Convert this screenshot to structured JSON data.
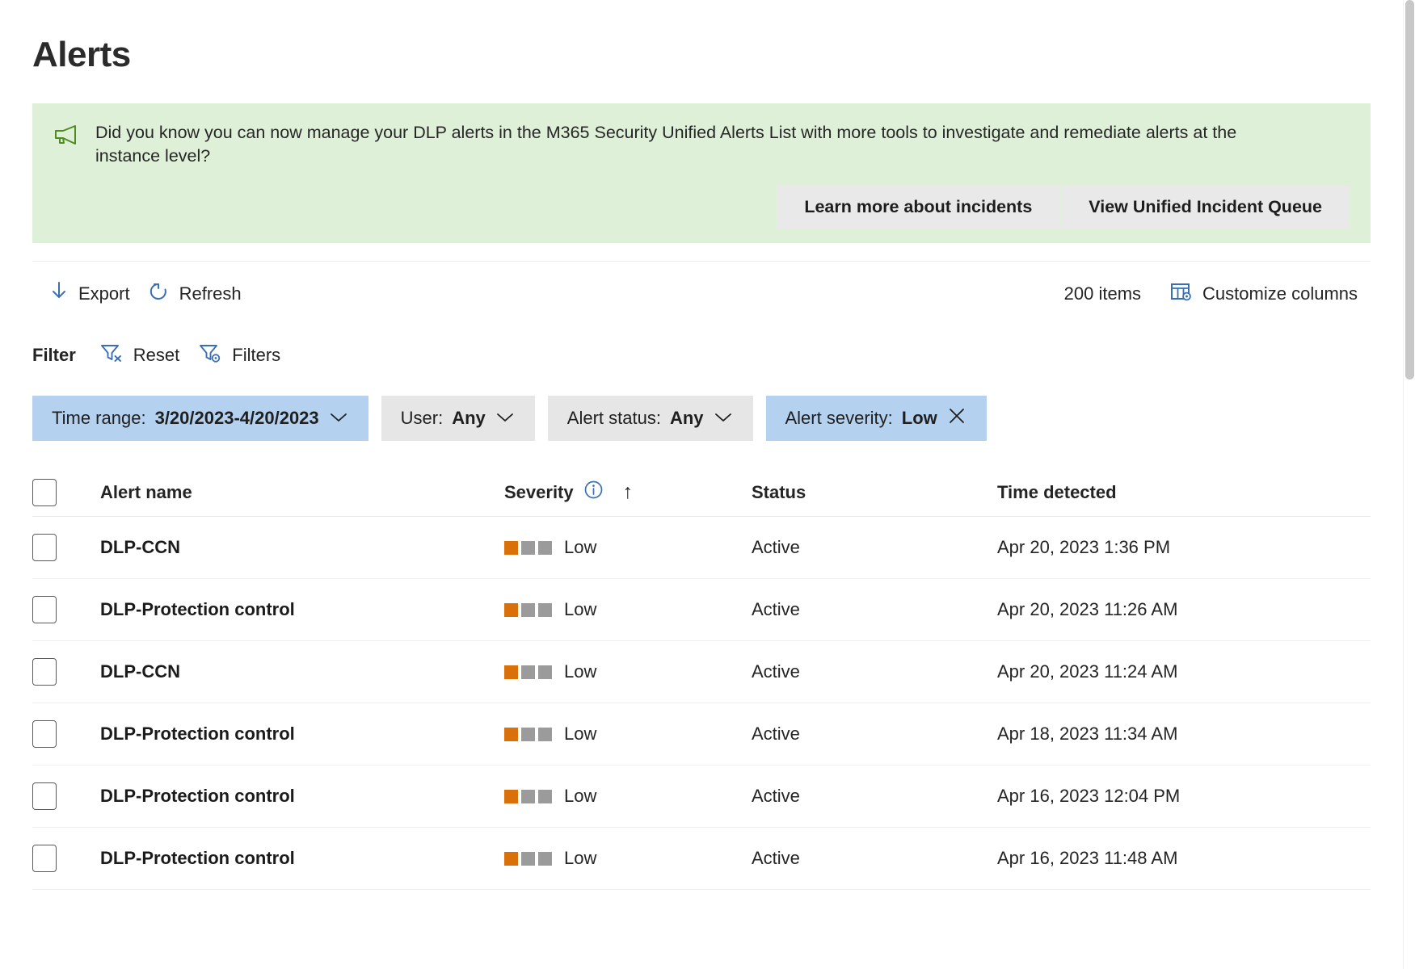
{
  "page": {
    "title": "Alerts"
  },
  "banner": {
    "icon": "megaphone-icon",
    "message": "Did you know you can now manage your DLP alerts in the M365 Security Unified Alerts List with more tools to investigate and remediate alerts at the instance level?",
    "learn_more_label": "Learn more about incidents",
    "view_queue_label": "View Unified Incident Queue",
    "background_color": "#dff0d8",
    "icon_color": "#4e8c1f"
  },
  "toolbar": {
    "export_label": "Export",
    "refresh_label": "Refresh",
    "items_count": "200 items",
    "customize_columns_label": "Customize columns",
    "accent_color": "#3a6fb5"
  },
  "filter_bar": {
    "label": "Filter",
    "reset_label": "Reset",
    "filters_label": "Filters"
  },
  "pills": [
    {
      "name": "time-range",
      "label": "Time range:",
      "value": "3/20/2023-4/20/2023",
      "active": true,
      "trailing": "chevron"
    },
    {
      "name": "user",
      "label": "User:",
      "value": "Any",
      "active": false,
      "trailing": "chevron"
    },
    {
      "name": "alert-status",
      "label": "Alert status:",
      "value": "Any",
      "active": false,
      "trailing": "chevron"
    },
    {
      "name": "alert-severity",
      "label": "Alert severity:",
      "value": "Low",
      "active": true,
      "trailing": "close"
    }
  ],
  "table": {
    "columns": {
      "alert_name": "Alert name",
      "severity": "Severity",
      "status": "Status",
      "time_detected": "Time detected"
    },
    "sort": {
      "column": "severity",
      "direction": "ascending",
      "glyph": "↑"
    },
    "severity_colors": {
      "filled": "#d9700a",
      "empty": "#9b9b9b"
    },
    "rows": [
      {
        "name": "DLP-CCN",
        "severity": "Low",
        "severity_level": 1,
        "status": "Active",
        "time": "Apr 20, 2023 1:36 PM"
      },
      {
        "name": "DLP-Protection control",
        "severity": "Low",
        "severity_level": 1,
        "status": "Active",
        "time": "Apr 20, 2023 11:26 AM"
      },
      {
        "name": "DLP-CCN",
        "severity": "Low",
        "severity_level": 1,
        "status": "Active",
        "time": "Apr 20, 2023 11:24 AM"
      },
      {
        "name": "DLP-Protection control",
        "severity": "Low",
        "severity_level": 1,
        "status": "Active",
        "time": "Apr 18, 2023 11:34 AM"
      },
      {
        "name": "DLP-Protection control",
        "severity": "Low",
        "severity_level": 1,
        "status": "Active",
        "time": "Apr 16, 2023 12:04 PM"
      },
      {
        "name": "DLP-Protection control",
        "severity": "Low",
        "severity_level": 1,
        "status": "Active",
        "time": "Apr 16, 2023 11:48 AM"
      }
    ]
  }
}
